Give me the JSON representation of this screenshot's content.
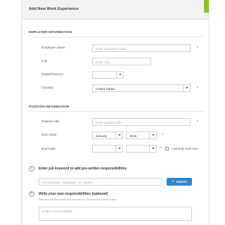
{
  "modal": {
    "title": "Add New Work Experience"
  },
  "employer_section": {
    "title": "EMPLOYER INFORMATION",
    "fields": {
      "employer_name": {
        "label": "Employer name",
        "placeholder": "Enter employer name",
        "required": "*"
      },
      "city": {
        "label": "City",
        "placeholder": "Enter City"
      },
      "state": {
        "label": "State/Province",
        "value": ""
      },
      "country": {
        "label": "Country",
        "value": "United States",
        "required": "*"
      }
    }
  },
  "position_section": {
    "title": "POSITION INFORMATION",
    "fields": {
      "position_title": {
        "label": "Position title",
        "placeholder": "Enter position title",
        "required": "*"
      },
      "start_date": {
        "label": "Start Date",
        "month": "January",
        "year": "2016",
        "required": "*"
      },
      "end_date": {
        "label": "End Date",
        "month": "",
        "year": "",
        "required": "*"
      },
      "currently_work_here": "I currently work here"
    }
  },
  "responsibilities": {
    "step1": {
      "number": "1",
      "title": "Enter job keyword to add pre-written responsibilities",
      "placeholder": "For example, \"Manager\", or \"Sales\"",
      "button": "Search"
    },
    "step2": {
      "number": "2",
      "title": "Write your own responsibilities (optional)",
      "hint": "Write each individual bullet point, then click the \"Save and Add Another\" button.",
      "placeholder": "Enter a responsibility"
    }
  },
  "colors": {
    "accent_green": "#8fbd2d",
    "button_blue": "#2a86d3"
  },
  "icons": {
    "search": "magnifier"
  }
}
